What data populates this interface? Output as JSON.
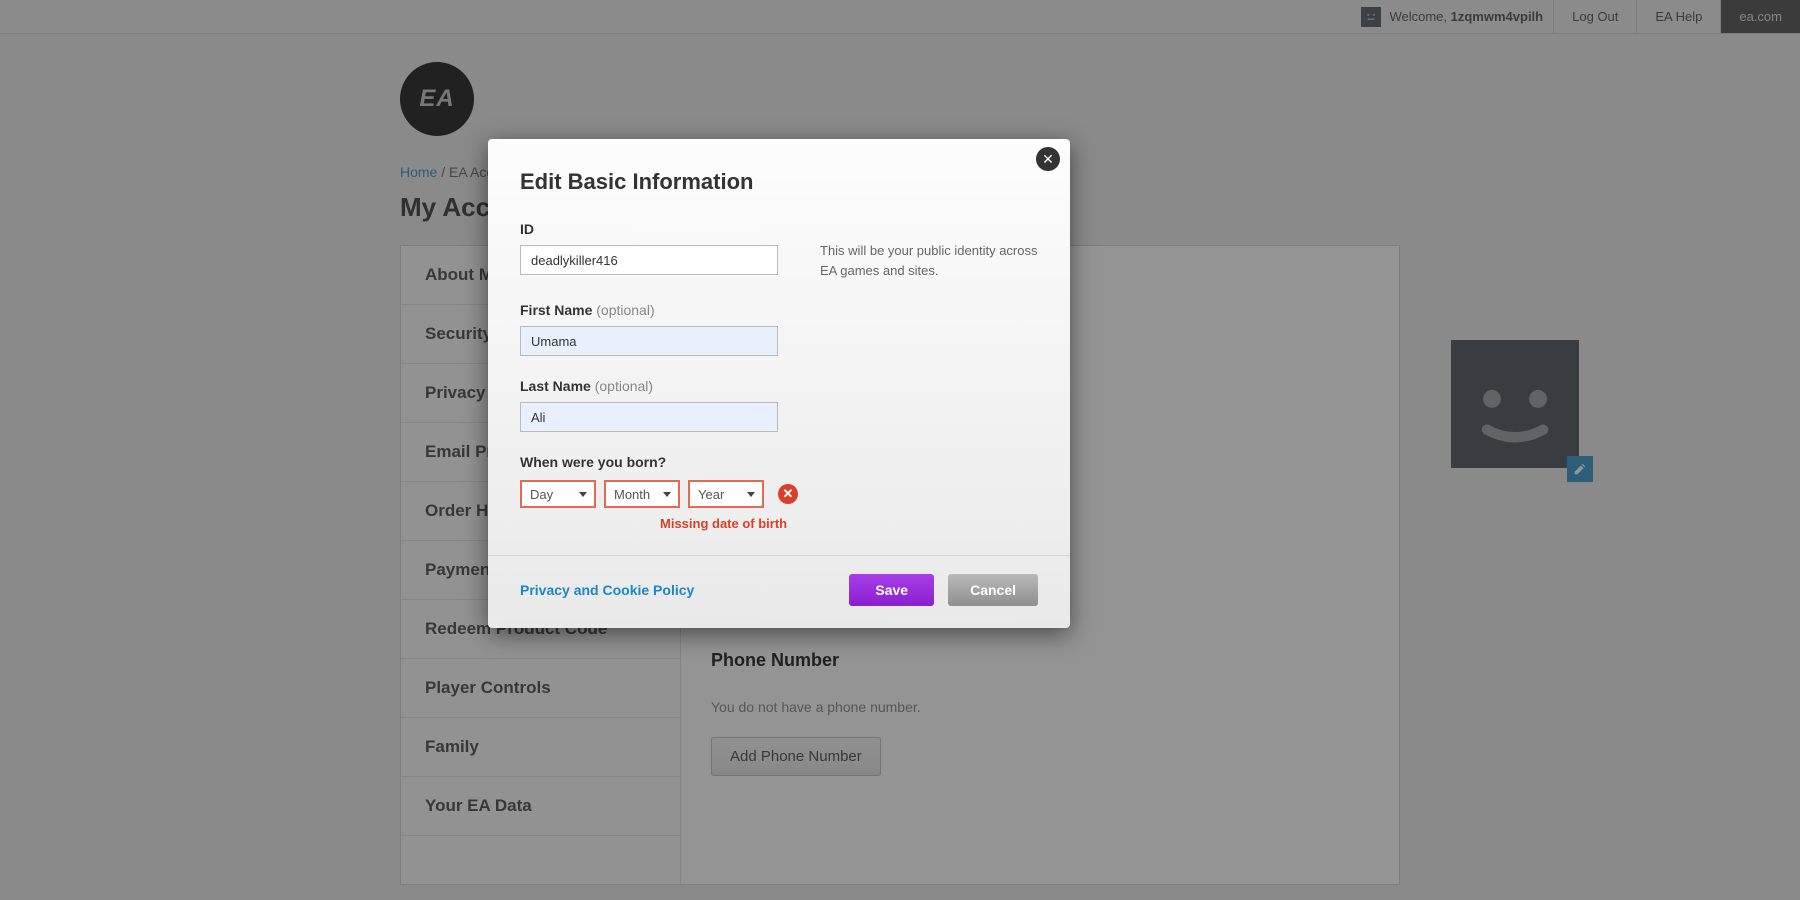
{
  "topbar": {
    "welcome_prefix": "Welcome,",
    "username": "1zqmwm4vpilh",
    "logout": "Log Out",
    "help": "EA Help",
    "eacom": "ea.com"
  },
  "logo_text": "EA",
  "breadcrumb": {
    "home": "Home",
    "sep": "/",
    "current": "EA Account"
  },
  "page_title": "My Account: About Me",
  "sidebar": {
    "items": [
      "About Me",
      "Security",
      "Privacy Settings",
      "Email Preferences",
      "Order History",
      "Payment Methods",
      "Redeem Product Code",
      "Player Controls",
      "Family",
      "Your EA Data"
    ]
  },
  "main": {
    "phone_heading": "Phone Number",
    "phone_note": "You do not have a phone number.",
    "add_phone_btn": "Add Phone Number"
  },
  "modal": {
    "title": "Edit Basic Information",
    "id_label": "ID",
    "id_value": "deadlykiller416",
    "id_help": "This will be your public identity across EA games and sites.",
    "first_name_label": "First Name",
    "optional": "(optional)",
    "first_name_value": "Umama",
    "last_name_label": "Last Name",
    "last_name_value": "Ali",
    "dob_label": "When were you born?",
    "dob_day": "Day",
    "dob_month": "Month",
    "dob_year": "Year",
    "dob_error": "Missing date of birth",
    "policy": "Privacy and Cookie Policy",
    "save": "Save",
    "cancel": "Cancel"
  },
  "colors": {
    "accent_link": "#1a88c4",
    "primary_btn": "#8b1fd1",
    "error": "#d9402b"
  }
}
